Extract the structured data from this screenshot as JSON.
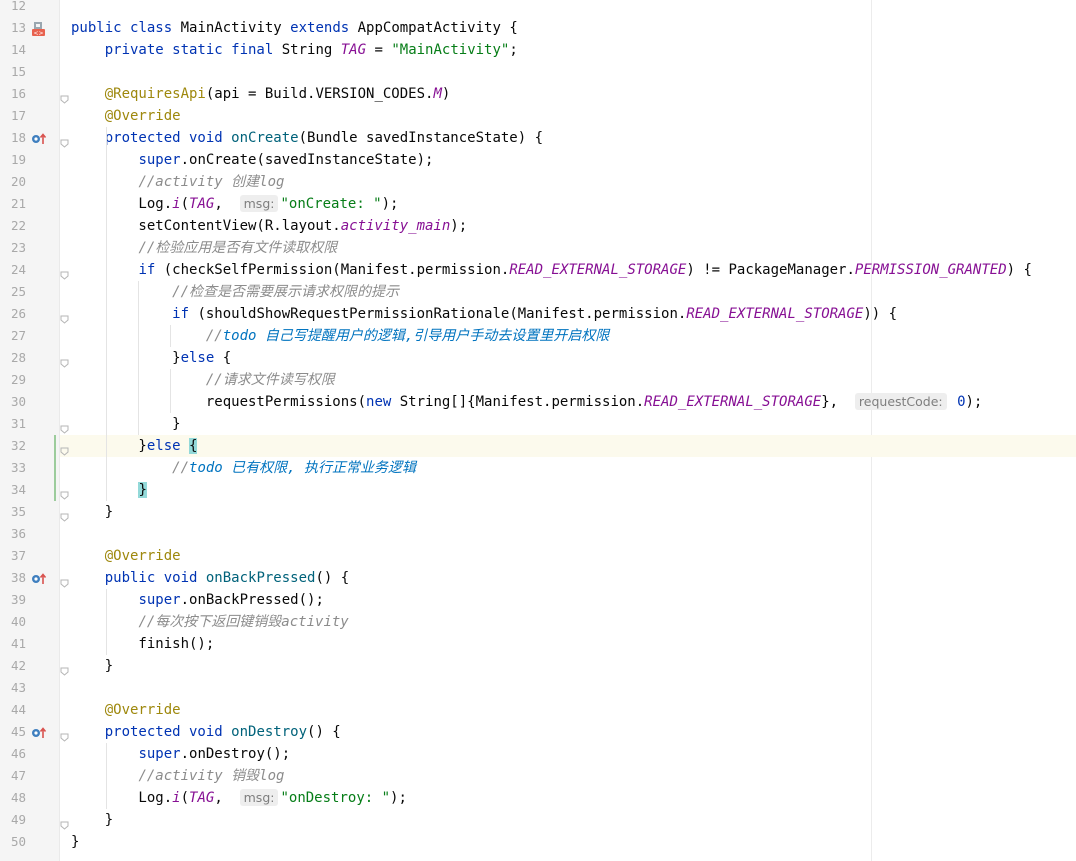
{
  "editor": {
    "lines": [
      {
        "n": "12",
        "t": []
      },
      {
        "n": "13",
        "marker": "class-icon",
        "t": [
          [
            "kw",
            "public "
          ],
          [
            "kw",
            "class "
          ],
          [
            "",
            "MainActivity "
          ],
          [
            "kw",
            "extends "
          ],
          [
            "",
            "AppCompatActivity {"
          ]
        ]
      },
      {
        "n": "14",
        "t": [
          [
            "",
            "    "
          ],
          [
            "kw",
            "private static final "
          ],
          [
            "",
            "String "
          ],
          [
            "fld",
            "TAG"
          ],
          [
            "",
            " = "
          ],
          [
            "str",
            "\"MainActivity\""
          ],
          [
            "",
            ";"
          ]
        ]
      },
      {
        "n": "15",
        "t": []
      },
      {
        "n": "16",
        "fold": true,
        "t": [
          [
            "",
            "    "
          ],
          [
            "an",
            "@RequiresApi"
          ],
          [
            "",
            "(api = Build.VERSION_CODES."
          ],
          [
            "fld",
            "M"
          ],
          [
            "",
            ")"
          ]
        ]
      },
      {
        "n": "17",
        "t": [
          [
            "",
            "    "
          ],
          [
            "an",
            "@Override"
          ]
        ]
      },
      {
        "n": "18",
        "marker": "override-icon",
        "fold": true,
        "t": [
          [
            "",
            "    "
          ],
          [
            "kw",
            "protected void "
          ],
          [
            "fn",
            "onCreate"
          ],
          [
            "",
            "(Bundle savedInstanceState) {"
          ]
        ]
      },
      {
        "n": "19",
        "t": [
          [
            "",
            "        "
          ],
          [
            "kw",
            "super"
          ],
          [
            "",
            ".onCreate(savedInstanceState);"
          ]
        ]
      },
      {
        "n": "20",
        "t": [
          [
            "",
            "        "
          ],
          [
            "cm",
            "//activity 创建log"
          ]
        ]
      },
      {
        "n": "21",
        "t": [
          [
            "",
            "        Log."
          ],
          [
            "fld",
            "i"
          ],
          [
            "",
            "("
          ],
          [
            "fld",
            "TAG"
          ],
          [
            "",
            ",  "
          ],
          [
            "hint",
            "msg:"
          ],
          [
            "str",
            "\"onCreate: \""
          ],
          [
            "",
            ");"
          ]
        ]
      },
      {
        "n": "22",
        "t": [
          [
            "",
            "        setContentView(R.layout."
          ],
          [
            "fld",
            "activity_main"
          ],
          [
            "",
            ");"
          ]
        ]
      },
      {
        "n": "23",
        "t": [
          [
            "",
            "        "
          ],
          [
            "cm",
            "//检验应用是否有文件读取权限"
          ]
        ]
      },
      {
        "n": "24",
        "fold": true,
        "t": [
          [
            "",
            "        "
          ],
          [
            "kw",
            "if "
          ],
          [
            "",
            "(checkSelfPermission(Manifest.permission."
          ],
          [
            "fld",
            "READ_EXTERNAL_STORAGE"
          ],
          [
            "",
            ") != PackageManager."
          ],
          [
            "fld",
            "PERMISSION_GRANTED"
          ],
          [
            "",
            ") {"
          ]
        ]
      },
      {
        "n": "25",
        "t": [
          [
            "",
            "            "
          ],
          [
            "cm",
            "//检查是否需要展示请求权限的提示"
          ]
        ]
      },
      {
        "n": "26",
        "fold": true,
        "t": [
          [
            "",
            "            "
          ],
          [
            "kw",
            "if "
          ],
          [
            "",
            "(shouldShowRequestPermissionRationale(Manifest.permission."
          ],
          [
            "fld",
            "READ_EXTERNAL_STORAGE"
          ],
          [
            "",
            ")) {"
          ]
        ]
      },
      {
        "n": "27",
        "t": [
          [
            "",
            "                "
          ],
          [
            "cm",
            "//"
          ],
          [
            "td",
            "todo 自己写提醒用户的逻辑,引导用户手动去设置里开启权限"
          ]
        ]
      },
      {
        "n": "28",
        "fold": true,
        "t": [
          [
            "",
            "            }"
          ],
          [
            "kw",
            "else "
          ],
          [
            "",
            "{"
          ]
        ]
      },
      {
        "n": "29",
        "t": [
          [
            "",
            "                "
          ],
          [
            "cm",
            "//请求文件读写权限"
          ]
        ]
      },
      {
        "n": "30",
        "t": [
          [
            "",
            "                requestPermissions("
          ],
          [
            "kw",
            "new "
          ],
          [
            "",
            "String[]{Manifest.permission."
          ],
          [
            "fld",
            "READ_EXTERNAL_STORAGE"
          ],
          [
            "",
            "},  "
          ],
          [
            "hint",
            "requestCode:"
          ],
          [
            "kw",
            " 0"
          ],
          [
            "",
            ");"
          ]
        ]
      },
      {
        "n": "31",
        "fold": true,
        "t": [
          [
            "",
            "            }"
          ]
        ]
      },
      {
        "n": "32",
        "fold": true,
        "highlight": true,
        "t": [
          [
            "",
            "        }"
          ],
          [
            "kw",
            "else "
          ],
          [
            "match",
            "{"
          ]
        ]
      },
      {
        "n": "33",
        "t": [
          [
            "",
            "            "
          ],
          [
            "cm",
            "//"
          ],
          [
            "td",
            "todo 已有权限, 执行正常业务逻辑"
          ]
        ]
      },
      {
        "n": "34",
        "fold": true,
        "t": [
          [
            "",
            "        "
          ],
          [
            "match",
            "}"
          ]
        ]
      },
      {
        "n": "35",
        "fold": true,
        "t": [
          [
            "",
            "    }"
          ]
        ]
      },
      {
        "n": "36",
        "t": []
      },
      {
        "n": "37",
        "t": [
          [
            "",
            "    "
          ],
          [
            "an",
            "@Override"
          ]
        ]
      },
      {
        "n": "38",
        "marker": "override-icon",
        "fold": true,
        "t": [
          [
            "",
            "    "
          ],
          [
            "kw",
            "public void "
          ],
          [
            "fn",
            "onBackPressed"
          ],
          [
            "",
            "() {"
          ]
        ]
      },
      {
        "n": "39",
        "t": [
          [
            "",
            "        "
          ],
          [
            "kw",
            "super"
          ],
          [
            "",
            ".onBackPressed();"
          ]
        ]
      },
      {
        "n": "40",
        "t": [
          [
            "",
            "        "
          ],
          [
            "cm",
            "//每次按下返回键销毁activity"
          ]
        ]
      },
      {
        "n": "41",
        "t": [
          [
            "",
            "        finish();"
          ]
        ]
      },
      {
        "n": "42",
        "fold": true,
        "t": [
          [
            "",
            "    }"
          ]
        ]
      },
      {
        "n": "43",
        "t": []
      },
      {
        "n": "44",
        "t": [
          [
            "",
            "    "
          ],
          [
            "an",
            "@Override"
          ]
        ]
      },
      {
        "n": "45",
        "marker": "override-icon",
        "fold": true,
        "t": [
          [
            "",
            "    "
          ],
          [
            "kw",
            "protected void "
          ],
          [
            "fn",
            "onDestroy"
          ],
          [
            "",
            "() {"
          ]
        ]
      },
      {
        "n": "46",
        "t": [
          [
            "",
            "        "
          ],
          [
            "kw",
            "super"
          ],
          [
            "",
            ".onDestroy();"
          ]
        ]
      },
      {
        "n": "47",
        "t": [
          [
            "",
            "        "
          ],
          [
            "cm",
            "//activity 销毁log"
          ]
        ]
      },
      {
        "n": "48",
        "t": [
          [
            "",
            "        Log."
          ],
          [
            "fld",
            "i"
          ],
          [
            "",
            "("
          ],
          [
            "fld",
            "TAG"
          ],
          [
            "",
            ",  "
          ],
          [
            "hint",
            "msg:"
          ],
          [
            "str",
            "\"onDestroy: \""
          ],
          [
            "",
            ");"
          ]
        ]
      },
      {
        "n": "49",
        "fold": true,
        "t": [
          [
            "",
            "    }"
          ]
        ]
      },
      {
        "n": "50",
        "t": [
          [
            "",
            "}"
          ]
        ]
      }
    ]
  },
  "colors": {
    "keyword": "#0033b3",
    "annotation": "#9e880d",
    "string": "#067d17",
    "field": "#871094",
    "comment": "#8c8c8c",
    "todo": "#0073bf",
    "method": "#00627a",
    "current_line": "#fcfaed",
    "brace_match": "#93d9d9"
  }
}
